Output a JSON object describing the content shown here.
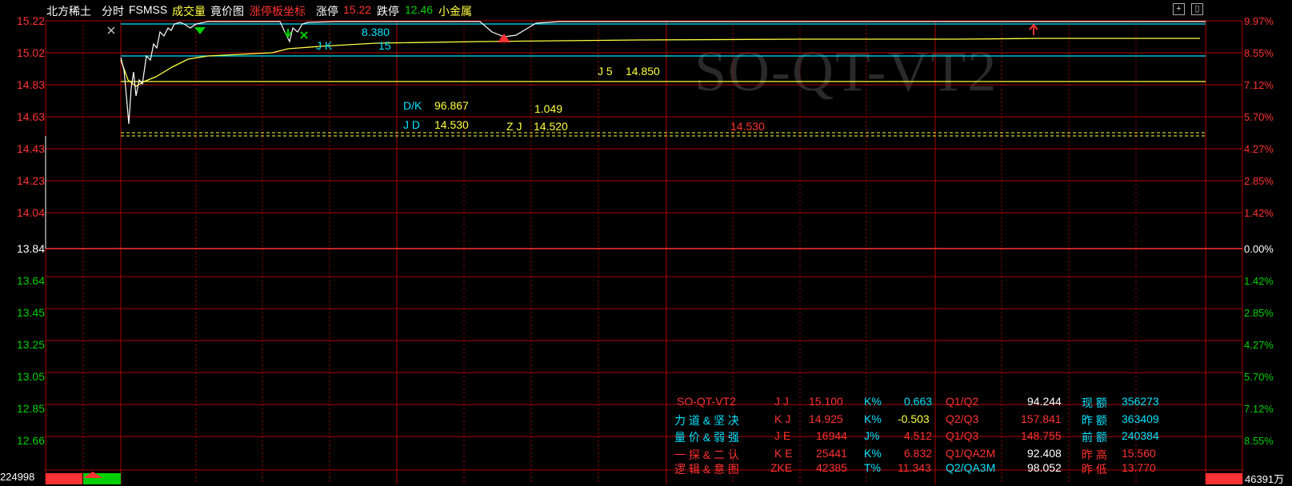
{
  "header": {
    "stock_name": "北方稀土",
    "mode": "分时",
    "indicator": "FSMSS",
    "volume_label": "成交量",
    "auction_label": "竟价图",
    "limit_coord_label": "涨停板坐标",
    "limit_up_label": "涨停",
    "limit_up_value": "15.22",
    "limit_down_label": "跌停",
    "limit_down_value": "12.46",
    "sector_label": "小金属"
  },
  "colors": {
    "up": "#ff3333",
    "down": "#00d000",
    "grid": "#b00000",
    "cyan": "#00e5ff",
    "yellow": "#ffff40"
  },
  "price_axis": {
    "left": [
      "15.22",
      "15.02",
      "14.83",
      "14.63",
      "14.43",
      "14.23",
      "14.04",
      "13.84",
      "13.64",
      "13.45",
      "13.25",
      "13.05",
      "12.85",
      "12.66"
    ],
    "right": [
      "9.97%",
      "8.55%",
      "7.12%",
      "5.70%",
      "4.27%",
      "2.85%",
      "1.42%",
      "0.00%",
      "1.42%",
      "2.85%",
      "4.27%",
      "5.70%",
      "7.12%",
      "8.55%"
    ]
  },
  "volume_left": "224998",
  "volume_right": "46391万",
  "annotations": {
    "jk": "J K",
    "val_8380": "8.380",
    "val_15": "15",
    "j5": "J 5",
    "j5_value": "14.850",
    "dk": "D/K",
    "dk_value": "96.867",
    "val_1049": "1.049",
    "jd": "J D",
    "jd_value": "14.530",
    "zj": "Z J",
    "zj_value": "14.520",
    "red_value": "14.530",
    "watermark": "SO-QT-VT2"
  },
  "table": [
    [
      "SO-QT-VT2",
      "J J",
      "15.100",
      "K%",
      "0.663",
      "Q1/Q2",
      "94.244",
      "现 额",
      "356273"
    ],
    [
      "力 道 & 坚 决",
      "K J",
      "14.925",
      "K%",
      "-0.503",
      "Q2/Q3",
      "157.841",
      "昨 额",
      "363409"
    ],
    [
      "量 价 & 弱 强",
      "J E",
      "16944",
      "J%",
      "4.512",
      "Q1/Q3",
      "148.755",
      "前 额",
      "240384"
    ],
    [
      "一 探 & 二 认",
      "K E",
      "25441",
      "K%",
      "6.832",
      "Q1/QA2M",
      "92.408",
      "昨 高",
      "15.560"
    ],
    [
      "逻 辑 & 意 图",
      "ZKE",
      "42385",
      "T%",
      "11.343",
      "Q2/QA3M",
      "98.052",
      "昨 低",
      "13.770"
    ]
  ]
}
